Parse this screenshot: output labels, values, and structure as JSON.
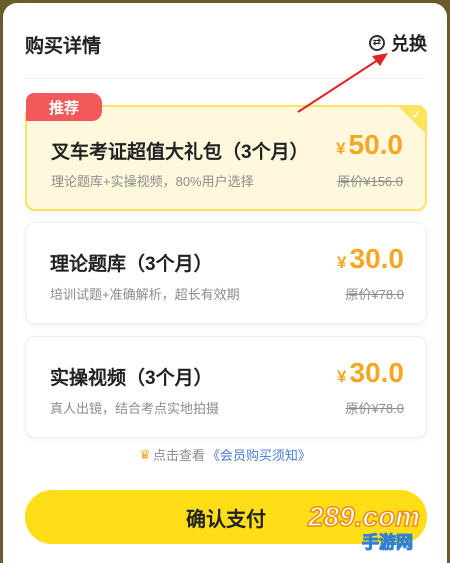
{
  "header": {
    "title": "购买详情",
    "exchange_label": "兑换",
    "exchange_icon": "exchange-icon"
  },
  "recommend_badge": "推荐",
  "plans": [
    {
      "name": "叉车考证超值大礼包（3个月）",
      "desc": "理论题库+实操视频，80%用户选择",
      "currency": "¥",
      "price": "50.0",
      "original": "原价¥156.0",
      "selected": true
    },
    {
      "name": "理论题库（3个月）",
      "desc": "培训试题+准确解析，超长有效期",
      "currency": "¥",
      "price": "30.0",
      "original": "原价¥78.0",
      "selected": false
    },
    {
      "name": "实操视频（3个月）",
      "desc": "真人出镜，结合考点实地拍摄",
      "currency": "¥",
      "price": "30.0",
      "original": "原价¥78.0",
      "selected": false
    }
  ],
  "notice": {
    "prefix": "点击查看",
    "link": "《会员购买须知》"
  },
  "pay_button": "确认支付",
  "watermark": {
    "top": "289.com",
    "bottom": "手游网"
  },
  "colors": {
    "accent": "#ffde17",
    "price": "#f5a623",
    "badge": "#f2595a",
    "link": "#4a7bd8",
    "arrow": "#e02424"
  }
}
